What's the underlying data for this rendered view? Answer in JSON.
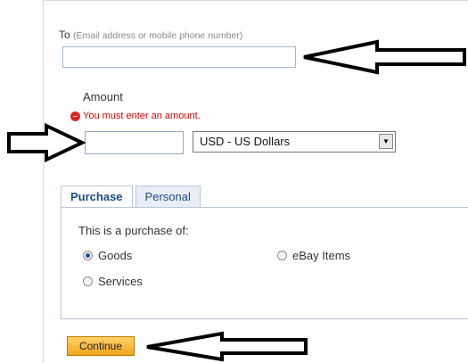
{
  "form": {
    "to_label": "To",
    "to_hint": "(Email address or mobile phone number)",
    "to_value": "",
    "amount_label": "Amount",
    "error_text": "You must enter an amount.",
    "amount_value": "",
    "currency_selected": "USD - US Dollars"
  },
  "tabs": [
    {
      "label": "Purchase"
    },
    {
      "label": "Personal"
    }
  ],
  "purchase": {
    "question": "This is a purchase of:",
    "options": [
      {
        "label": "Goods",
        "checked": true
      },
      {
        "label": "eBay Items",
        "checked": false
      },
      {
        "label": "Services",
        "checked": false
      }
    ]
  },
  "actions": {
    "continue_label": "Continue"
  },
  "colors": {
    "accent": "#1c4d86",
    "error": "#d20000",
    "button": "#f2a51b",
    "arrow": "#000000"
  },
  "icons": {
    "error": "alert-circle-icon",
    "dropdown": "chevron-down-icon",
    "arrows": "annotation-arrow-icon"
  }
}
